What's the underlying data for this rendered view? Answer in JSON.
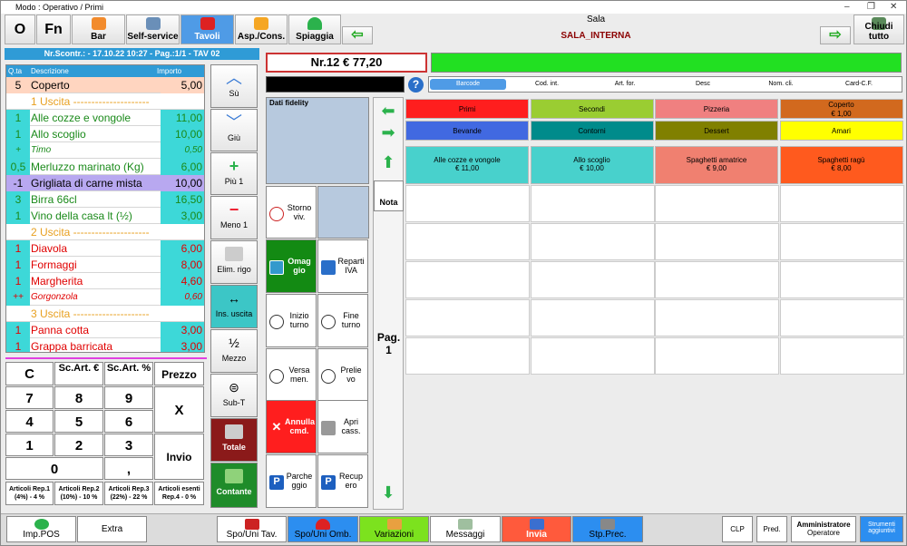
{
  "window": {
    "title": "Modo : Operativo / Primi"
  },
  "toolbar": {
    "o": "O",
    "fn": "Fn",
    "bar": "Bar",
    "self": "Self-service",
    "tavoli": "Tavoli",
    "asp": "Asp./Cons.",
    "spiaggia": "Spiaggia",
    "sala_label": "Sala",
    "sala_name": "SALA_INTERNA",
    "chiudi": "Chiudi tutto"
  },
  "receipt": {
    "header": "Nr.Scontr.: - 17.10.22 10:27 - Pag.:1/1 - TAV 02",
    "col_qty": "Q.ta",
    "col_desc": "Descrizione",
    "col_price": "Importo",
    "rows": [
      {
        "q": "5",
        "d": "Coperto",
        "p": "5,00"
      },
      {
        "q": "",
        "d": "1 Uscita ---------------------",
        "p": ""
      },
      {
        "q": "1",
        "d": "Alle cozze e vongole",
        "p": "11,00"
      },
      {
        "q": "1",
        "d": "Allo scoglio",
        "p": "10,00"
      },
      {
        "q": "+",
        "d": "Timo",
        "p": "0,50"
      },
      {
        "q": "0,5",
        "d": "Merluzzo marinato (Kg)",
        "p": "6,00"
      },
      {
        "q": "-1",
        "d": "Grigliata di carne mista",
        "p": "10,00"
      },
      {
        "q": "3",
        "d": "Birra 66cl",
        "p": "16,50"
      },
      {
        "q": "1",
        "d": "Vino della casa lt (½)",
        "p": "3,00"
      },
      {
        "q": "",
        "d": "2 Uscita ---------------------",
        "p": ""
      },
      {
        "q": "1",
        "d": "Diavola",
        "p": "6,00"
      },
      {
        "q": "1",
        "d": "Formaggi",
        "p": "8,00"
      },
      {
        "q": "1",
        "d": "Margherita",
        "p": "4,60"
      },
      {
        "q": "++",
        "d": "Gorgonzola",
        "p": "0,60"
      },
      {
        "q": "",
        "d": "3 Uscita ---------------------",
        "p": ""
      },
      {
        "q": "1",
        "d": "Panna cotta",
        "p": "3,00"
      },
      {
        "q": "1",
        "d": "Grappa barricata",
        "p": "3,00"
      }
    ]
  },
  "side_buttons": {
    "su": "Sù",
    "giu": "Giù",
    "piu": "Più 1",
    "meno": "Meno 1",
    "elim": "Elim. rigo",
    "ins": "Ins. uscita",
    "mezzo": "Mezzo",
    "subt": "Sub-T",
    "totale": "Totale",
    "contante": "Contante"
  },
  "keypad": {
    "c": "C",
    "scartc": "Sc.Art. €",
    "scartp": "Sc.Art. %",
    "prezzo": "Prezzo",
    "k7": "7",
    "k8": "8",
    "k9": "9",
    "x": "X",
    "k4": "4",
    "k5": "5",
    "k6": "6",
    "k1": "1",
    "k2": "2",
    "k3": "3",
    "invio": "Invio",
    "k0": "0",
    "comma": ","
  },
  "reparti": [
    {
      "a": "Articoli Rep.1",
      "b": "(4%) - 4 %"
    },
    {
      "a": "Articoli Rep.2",
      "b": "(10%) - 10 %"
    },
    {
      "a": "Articoli Rep.3",
      "b": "(22%) - 22 %"
    },
    {
      "a": "Articoli esenti",
      "b": "Rep.4 - 0 %"
    }
  ],
  "total_display": "Nr.12 € 77,20",
  "search_tabs": [
    "Barcode",
    "Cod. int.",
    "Art. for.",
    "Desc",
    "Nom. cli.",
    "Card-C.F."
  ],
  "fidelity": "Dati fidelity",
  "func": {
    "storno": "Storno viv.",
    "omaggio": "Omag gio",
    "reparti_iva": "Reparti IVA",
    "inizio": "Inizio turno",
    "fine": "Fine turno",
    "versa": "Versa men.",
    "prelievo": "Prelie vo",
    "annulla": "Annulla cmd.",
    "apri": "Apri cass.",
    "parcheggio": "Parche ggio",
    "recupero": "Recup ero"
  },
  "nota": "Nota",
  "pag": "Pag.",
  "pag_num": "1",
  "categories": [
    {
      "n": "Primi",
      "c": "#ff1e1e",
      "t": "#000"
    },
    {
      "n": "Secondi",
      "c": "#9acd32",
      "t": "#000"
    },
    {
      "n": "Pizzeria",
      "c": "#f08080",
      "t": "#000"
    },
    {
      "n": "Coperto\n€ 1,00",
      "c": "#d2691e",
      "t": "#000"
    },
    {
      "n": "Bevande",
      "c": "#4169e1",
      "t": "#000"
    },
    {
      "n": "Contorni",
      "c": "#008b8b",
      "t": "#000"
    },
    {
      "n": "Dessert",
      "c": "#808000",
      "t": "#000"
    },
    {
      "n": "Amari",
      "c": "#ffff00",
      "t": "#000"
    }
  ],
  "products": [
    {
      "n": "Alle cozze e vongole",
      "p": "€ 11,00",
      "c": "#48d1cc"
    },
    {
      "n": "Allo scoglio",
      "p": "€ 10,00",
      "c": "#48d1cc"
    },
    {
      "n": "Spaghetti amatrice",
      "p": "€ 9,00",
      "c": "#f08070"
    },
    {
      "n": "Spaghetti ragù",
      "p": "€ 8,00",
      "c": "#ff5a1e"
    }
  ],
  "bottom": {
    "imppos": "Imp.POS",
    "extra": "Extra",
    "spotav": "Spo/Uni Tav.",
    "spoomb": "Spo/Uni Omb.",
    "variazioni": "Variazioni",
    "messaggi": "Messaggi",
    "invia": "Invia",
    "stpprec": "Stp.Prec.",
    "clp": "CLP",
    "pred": "Pred.",
    "admin": "Amministratore",
    "operatore": "Operatore",
    "strumenti": "Strumenti aggiuntivi"
  }
}
